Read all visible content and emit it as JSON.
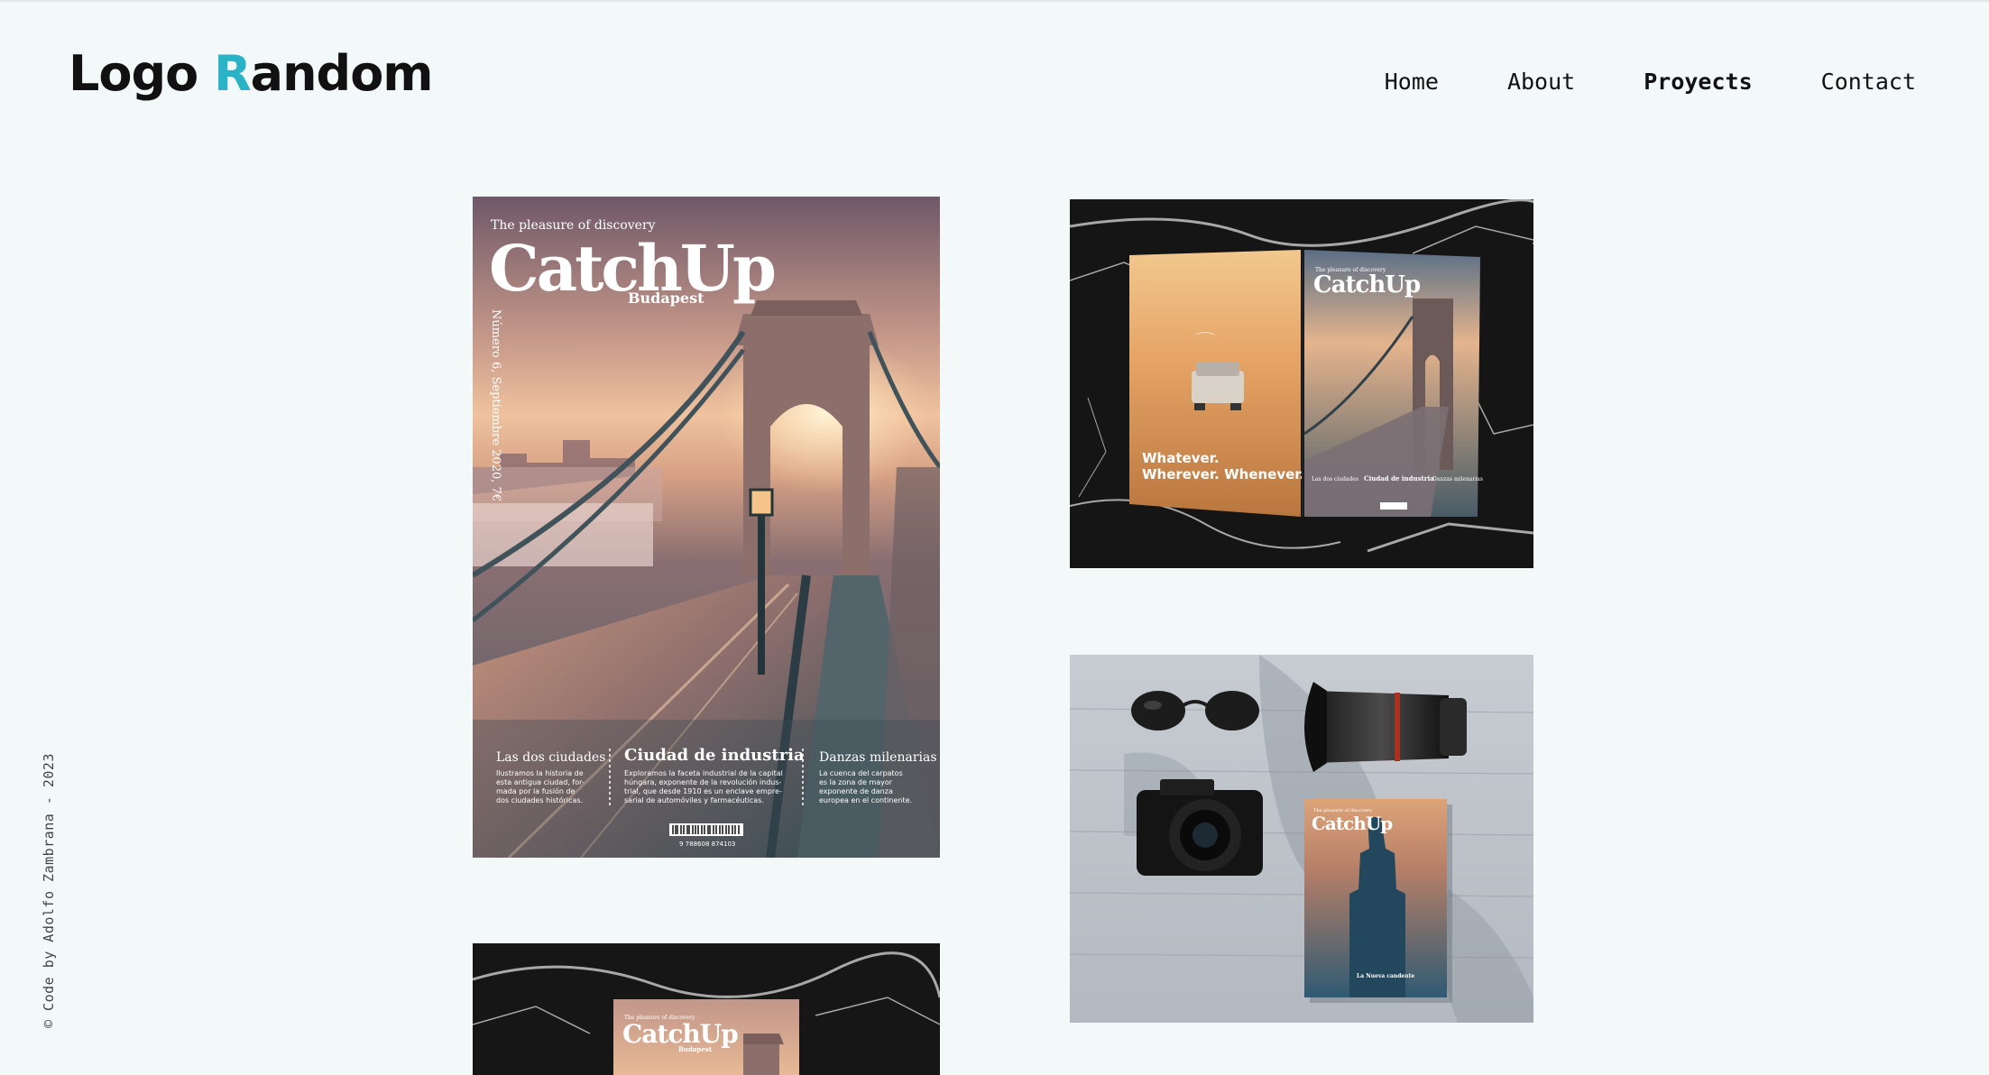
{
  "header": {
    "logo_first": "Logo",
    "logo_accent": "R",
    "logo_rest": "andom"
  },
  "nav": {
    "items": [
      {
        "label": "Home"
      },
      {
        "label": "About"
      },
      {
        "label": "Proyects",
        "active": true
      },
      {
        "label": "Contact"
      }
    ]
  },
  "credit": "© Code by Adolfo Zambrana - 2023",
  "colors": {
    "background": "#f3f9f9",
    "accent": "#2ab3c6",
    "text": "#111111"
  },
  "projects": [
    {
      "kicker": "The pleasure of discovery",
      "title": "CatchUp",
      "subtitle": "Budapest",
      "issue": "Número 6, Septiembre 2020, 7€",
      "articles": [
        {
          "heading": "Las dos ciudades",
          "lines": [
            "Ilustramos la historia de",
            "esta antigua ciudad, for-",
            "mada por la fusión de",
            "dos ciudades históricas."
          ]
        },
        {
          "heading": "Ciudad de industria",
          "lines": [
            "Exploramos la faceta industrial de la capital",
            "húngara, exponente de la revolución indus-",
            "trial, que desde 1910 es un enclave empre-",
            "sarial de automóviles y farmacéuticas."
          ]
        },
        {
          "heading": "Danzas milenarias",
          "lines": [
            "La cuenca del carpatos",
            "es la zona de mayor",
            "exponente de danza",
            "europea en el continente."
          ]
        }
      ],
      "barcode_number": "9 788608 874103"
    },
    {
      "kicker": "The pleasure of discovery",
      "title": "CatchUp",
      "ad_line1": "Whatever.",
      "ad_line2": "Wherever. Whenever.",
      "inner_headings": [
        "Las dos ciudades",
        "Ciudad de industria",
        "Danzas milenarias"
      ]
    },
    {
      "kicker": "The pleasure of discovery",
      "title": "CatchUp",
      "inner_heading": "La Nueva candente"
    },
    {
      "kicker": "The pleasure of discovery",
      "title": "CatchUp",
      "subtitle": "Budapest"
    }
  ]
}
